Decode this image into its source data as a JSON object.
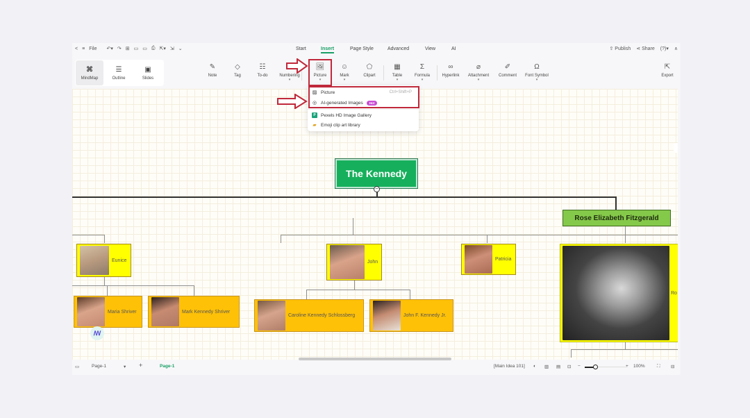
{
  "menubar": {
    "back": "<",
    "menu": "≡",
    "file": "File",
    "tabs": [
      "Start",
      "Insert",
      "Page Style",
      "Advanced",
      "View",
      "AI"
    ],
    "active_tab": "Insert",
    "publish": "Publish",
    "share": "Share",
    "help": "?"
  },
  "views": [
    {
      "label": "MindMap",
      "icon": "mindmap-icon",
      "active": true
    },
    {
      "label": "Outline",
      "icon": "outline-icon",
      "active": false
    },
    {
      "label": "Slides",
      "icon": "slides-icon",
      "active": false
    }
  ],
  "tools": [
    {
      "label": "Note",
      "icon": "note-icon",
      "caret": false
    },
    {
      "label": "Tag",
      "icon": "tag-icon",
      "caret": false
    },
    {
      "label": "To-do",
      "icon": "todo-icon",
      "caret": false
    },
    {
      "label": "Numbering",
      "icon": "numbering-icon",
      "caret": true
    },
    {
      "label": "Picture",
      "icon": "picture-icon",
      "caret": true
    },
    {
      "label": "Mark",
      "icon": "mark-icon",
      "caret": true
    },
    {
      "label": "Clipart",
      "icon": "clipart-icon",
      "caret": false
    },
    {
      "label": "Table",
      "icon": "table-icon",
      "caret": true
    },
    {
      "label": "Formula",
      "icon": "formula-icon",
      "caret": true
    },
    {
      "label": "Hyperlink",
      "icon": "hyperlink-icon",
      "caret": false
    },
    {
      "label": "Attachment",
      "icon": "attachment-icon",
      "caret": true
    },
    {
      "label": "Comment",
      "icon": "comment-icon",
      "caret": false
    },
    {
      "label": "Font Symbol",
      "icon": "omega-icon",
      "caret": true
    },
    {
      "label": "Export",
      "icon": "export-icon",
      "caret": false
    }
  ],
  "picture_menu": {
    "items": [
      {
        "label": "Picture",
        "shortcut": "Ctrl+Shift+P",
        "icon": "image-icon"
      },
      {
        "label": "AI-generated Images",
        "badge": "Hot",
        "icon": "ai-image-icon"
      },
      {
        "label": "Pexels HD Image Gallery",
        "icon": "pexels-icon"
      },
      {
        "label": "Emoji clip art library",
        "icon": "emoji-icon"
      }
    ]
  },
  "mindmap": {
    "root": "The Kennedy",
    "rose": "Rose Elizabeth Fitzgerald",
    "people": {
      "eunice": "Eunice",
      "maria": "Maria Shriver",
      "mark": "Mark Kennedy Shriver",
      "john": "John",
      "caroline": "Caroline Kennedy Schlossberg",
      "jfk_jr": "John F. Kennedy Jr.",
      "patricia": "Patricia",
      "robert": "Ro"
    }
  },
  "statusbar": {
    "page_select": "Page-1",
    "add": "+",
    "page_tab": "Page-1",
    "info": "[Main Idea 101]",
    "zoom_minus": "−",
    "zoom_plus": "+",
    "zoom": "100%",
    "zoom_fraction": 0.2
  },
  "colors": {
    "accent": "#1a9f66",
    "root_node": "#16b05c",
    "rose_node": "#85c94a",
    "child_node": "#ffff00",
    "grandchild_node": "#ffc107",
    "highlight": "#c0283a"
  }
}
